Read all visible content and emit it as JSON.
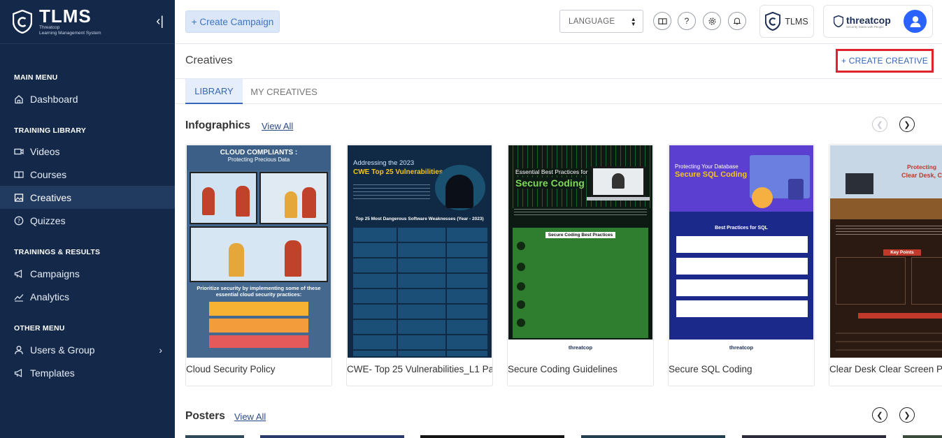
{
  "brand": {
    "title": "TLMS",
    "subtitle_line1": "Threatcop",
    "subtitle_line2": "Learning Management System"
  },
  "sidebar": {
    "sections": [
      {
        "heading": "MAIN MENU",
        "items": [
          {
            "label": "Dashboard",
            "icon": "home-icon"
          }
        ]
      },
      {
        "heading": "TRAINING LIBRARY",
        "items": [
          {
            "label": "Videos",
            "icon": "video-icon"
          },
          {
            "label": "Courses",
            "icon": "book-icon"
          },
          {
            "label": "Creatives",
            "icon": "image-icon",
            "active": true
          },
          {
            "label": "Quizzes",
            "icon": "question-icon"
          }
        ]
      },
      {
        "heading": "TRAININGS & RESULTS",
        "items": [
          {
            "label": "Campaigns",
            "icon": "megaphone-icon"
          },
          {
            "label": "Analytics",
            "icon": "chart-line-icon"
          }
        ]
      },
      {
        "heading": "OTHER MENU",
        "items": [
          {
            "label": "Users & Group",
            "icon": "user-icon"
          },
          {
            "label": "Templates",
            "icon": "megaphone-icon"
          }
        ]
      }
    ]
  },
  "topbar": {
    "create_campaign": "+ Create Campaign",
    "language": "LANGUAGE",
    "tlms_label": "TLMS",
    "threatcop_logo": "threatcop",
    "threatcop_tagline": "Security Starts with People"
  },
  "page": {
    "title": "Creatives",
    "create_creative": "+ CREATE CREATIVE"
  },
  "tabs": [
    {
      "label": "LIBRARY",
      "active": true
    },
    {
      "label": "MY CREATIVES",
      "active": false
    }
  ],
  "infographics": {
    "title": "Infographics",
    "view_all": "View All",
    "cards": [
      {
        "title": "Cloud Security Policy",
        "thumb": {
          "heading1": "CLOUD COMPLIANTS :",
          "heading2": "Protecting Precious Data",
          "footer": "Prioritize security by implementing some of these essential cloud security practices:"
        }
      },
      {
        "title": "CWE- Top 25 Vulnerabilities_L1 Pa...",
        "thumb": {
          "heading1": "Addressing the 2023",
          "heading2": "CWE Top 25 Vulnerabilities",
          "footer": "Top 25 Most Dangerous Software Weaknesses (Year - 2023)"
        }
      },
      {
        "title": "Secure Coding Guidelines",
        "thumb": {
          "heading1": "Essential Best Practices for",
          "heading2": "Secure Coding",
          "footer": "Secure Coding Best Practices",
          "brand": "threatcop"
        }
      },
      {
        "title": "Secure SQL Coding",
        "thumb": {
          "heading1": "Protecting Your Database",
          "heading2": "Secure SQL Coding",
          "footer": "Best Practices for SQL",
          "brand": "threatcop"
        }
      },
      {
        "title": "Clear Desk Clear Screen Po",
        "thumb": {
          "heading1": "Protecting",
          "heading2": "Clear Desk, C",
          "footer": "Key Points"
        }
      }
    ]
  },
  "posters": {
    "title": "Posters",
    "view_all": "View All"
  },
  "colors": {
    "sidebar": "#14294a",
    "accent": "#3566b8",
    "highlight": "#e0232a"
  }
}
